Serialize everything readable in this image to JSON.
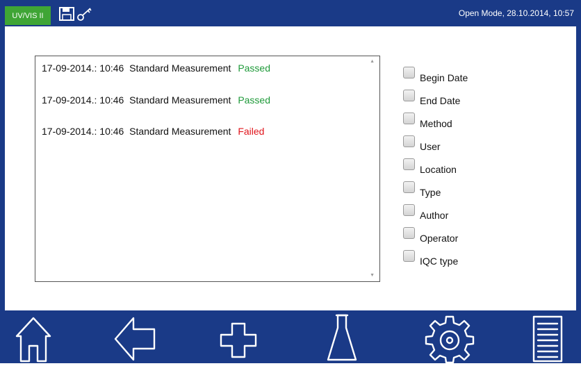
{
  "header": {
    "badge_label": "UV/VIS II",
    "status": "Open Mode, 28.10.2014, 10:57",
    "icons": [
      "save-icon",
      "key-icon"
    ],
    "colors": {
      "bar": "#1a3a87",
      "badge": "#3fa535"
    }
  },
  "log": {
    "entries": [
      {
        "date": "17-09-2014.: 10:46",
        "title": "Standard Measurement",
        "result": "Passed",
        "result_color": "#1f9a3a"
      },
      {
        "date": "17-09-2014.: 10:46",
        "title": "Standard Measurement",
        "result": "Passed",
        "result_color": "#1f9a3a"
      },
      {
        "date": "17-09-2014.: 10:46",
        "title": "Standard Measurement",
        "result": "Failed",
        "result_color": "#e0141b"
      }
    ]
  },
  "filters": [
    {
      "label": "Begin Date",
      "checked": false
    },
    {
      "label": "End Date",
      "checked": false
    },
    {
      "label": "Method",
      "checked": false
    },
    {
      "label": "User",
      "checked": false
    },
    {
      "label": "Location",
      "checked": false
    },
    {
      "label": "Type",
      "checked": false
    },
    {
      "label": "Author",
      "checked": false
    },
    {
      "label": "Operator",
      "checked": false
    },
    {
      "label": "IQC type",
      "checked": false
    }
  ],
  "nav": {
    "items": [
      "home-icon",
      "back-arrow-icon",
      "add-plus-icon",
      "flask-icon",
      "settings-gear-icon",
      "list-menu-icon"
    ]
  }
}
